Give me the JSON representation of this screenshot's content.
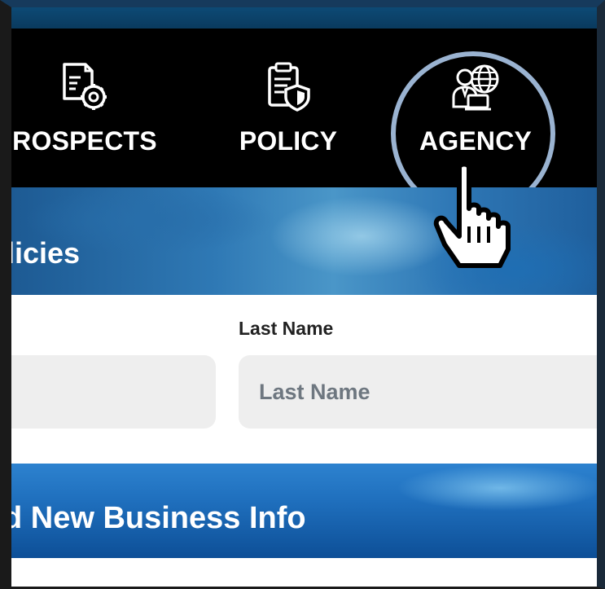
{
  "nav": {
    "items": [
      {
        "label": "ROSPECTS",
        "icon": "document-gear-icon"
      },
      {
        "label": "POLICY",
        "icon": "policy-shield-icon"
      },
      {
        "label": "AGENCY",
        "icon": "agent-globe-icon"
      }
    ],
    "highlighted": "AGENCY"
  },
  "hero": {
    "title": "licies"
  },
  "form": {
    "last_name_label": "Last Name",
    "last_name_placeholder": "Last Name"
  },
  "banner": {
    "title": "d New Business Info"
  },
  "colors": {
    "nav_bg": "#000000",
    "top_strip": "#0d4a75",
    "ring": "#9ab3d1",
    "input_bg": "#eeeeee",
    "placeholder": "#6e7780"
  }
}
